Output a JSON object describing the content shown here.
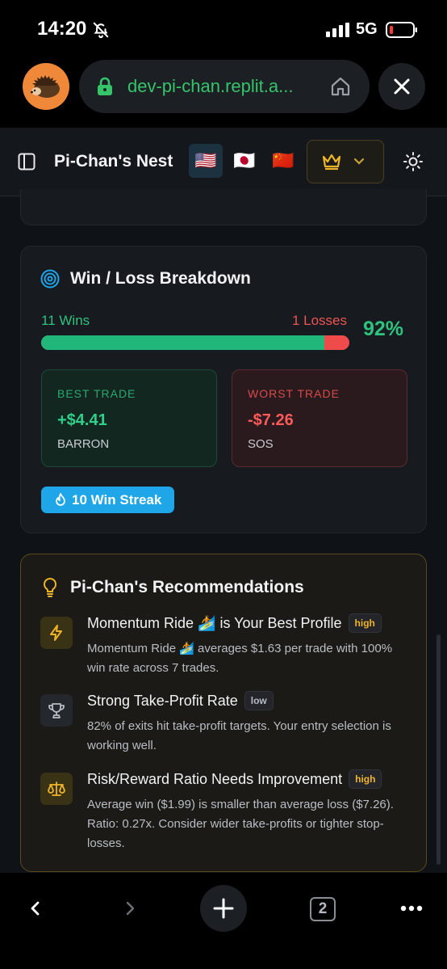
{
  "status": {
    "time": "14:20",
    "network": "5G"
  },
  "browser": {
    "url": "dev-pi-chan.replit.a..."
  },
  "header": {
    "title": "Pi-Chan's Nest",
    "flags": [
      "🇺🇸",
      "🇯🇵",
      "🇨🇳"
    ]
  },
  "winloss": {
    "title": "Win / Loss Breakdown",
    "wins_label": "11 Wins",
    "losses_label": "1 Losses",
    "win_rate": "92%",
    "win_fraction": 0.92,
    "best": {
      "label": "BEST TRADE",
      "value": "+$4.41",
      "symbol": "BARRON"
    },
    "worst": {
      "label": "WORST TRADE",
      "value": "-$7.26",
      "symbol": "SOS"
    },
    "streak": "10 Win Streak"
  },
  "recommendations": {
    "title": "Pi-Chan's Recommendations",
    "items": [
      {
        "title": "Momentum Ride 🏄 is Your Best Profile",
        "badge": "high",
        "body": "Momentum Ride 🏄 averages $1.63 per trade with 100% win rate across 7 trades."
      },
      {
        "title": "Strong Take-Profit Rate",
        "badge": "low",
        "body": "82% of exits hit take-profit targets. Your entry selection is working well."
      },
      {
        "title": "Risk/Reward Ratio Needs Improvement",
        "badge": "high",
        "body": "Average win ($1.99) is smaller than average loss ($7.26). Ratio: 0.27x. Consider wider take-profits or tighter stop-losses."
      }
    ]
  },
  "nav": {
    "tab_count": "2"
  },
  "colors": {
    "win": "#22b77a",
    "loss": "#ef4b4b",
    "accent": "#f0b429",
    "streak": "#1ea6e8"
  }
}
